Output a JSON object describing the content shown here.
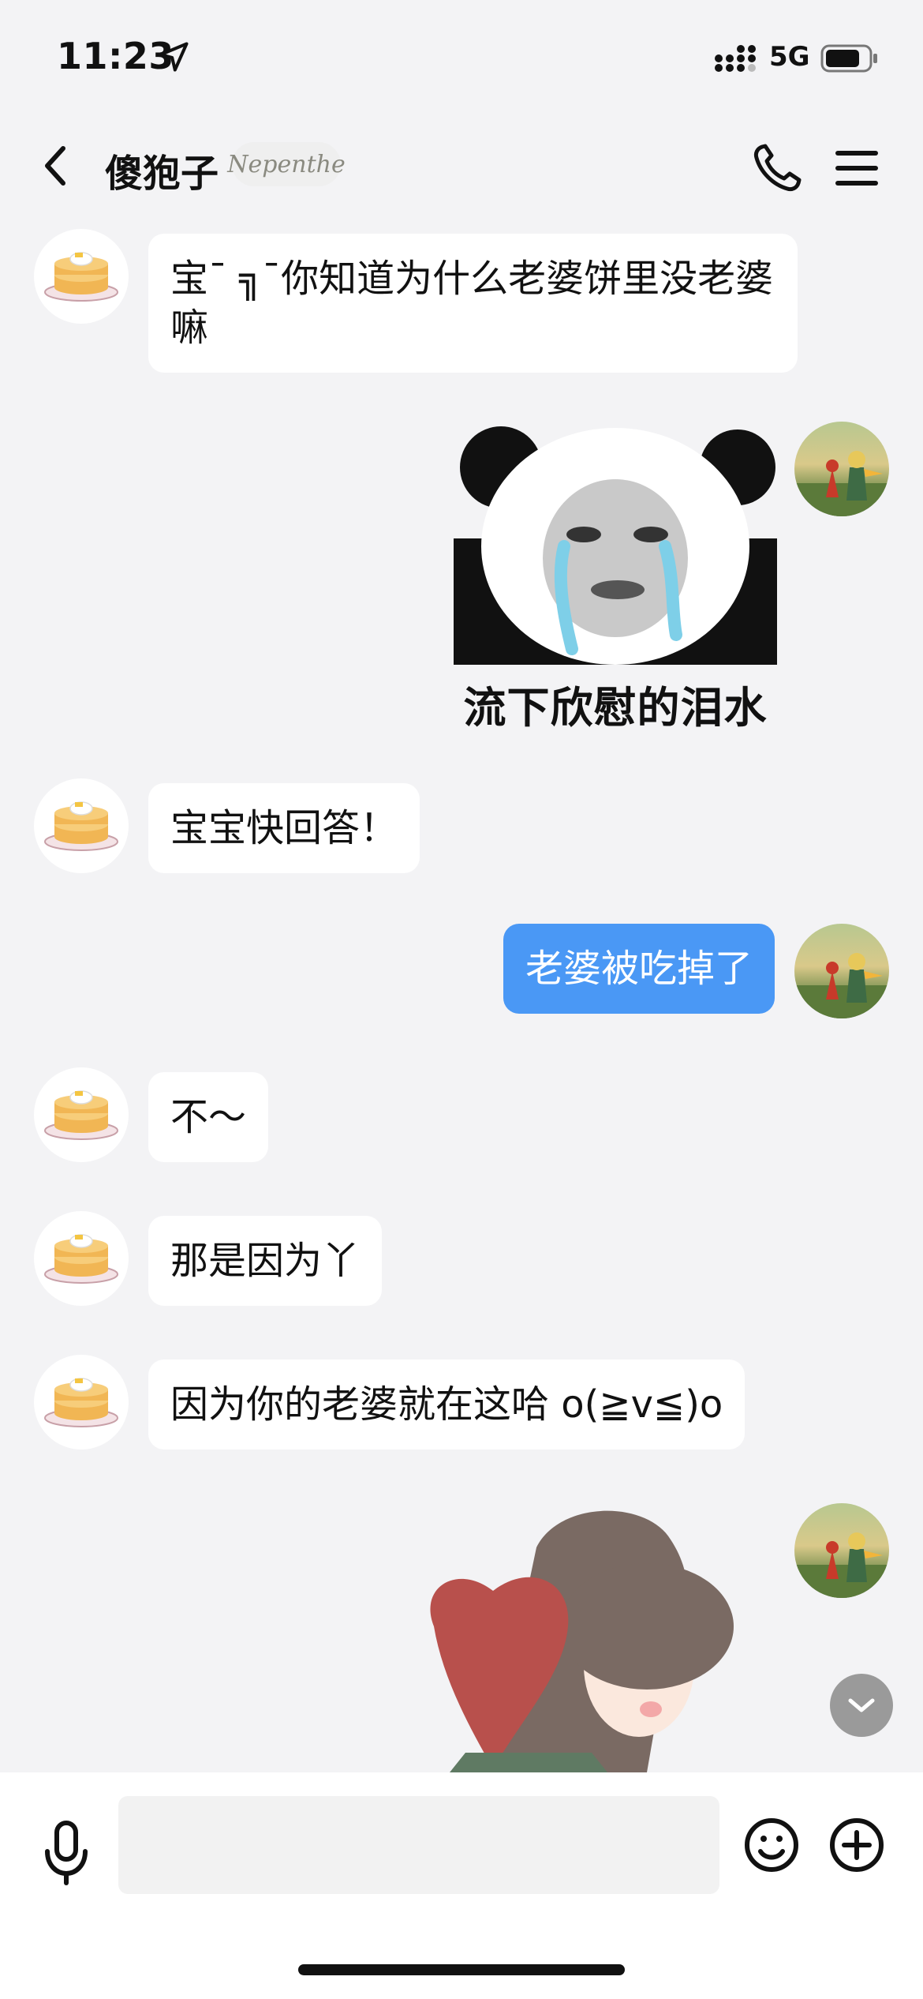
{
  "status_bar": {
    "time": "11:23",
    "network": "5G",
    "icons": [
      "location-arrow-icon",
      "signal-icon",
      "battery-icon"
    ]
  },
  "header": {
    "back_icon": "chevron-left-icon",
    "contact_name": "傻狍子",
    "badge_text": "Nepenthe",
    "call_icon": "phone-icon",
    "menu_icon": "menu-icon"
  },
  "messages": [
    {
      "sender": "contact",
      "type": "text",
      "text": "宝ˉ ╗ˉ你知道为什么老婆饼里没老婆嘛"
    },
    {
      "sender": "me",
      "type": "sticker",
      "caption": "流下欣慰的泪水"
    },
    {
      "sender": "contact",
      "type": "text",
      "text": "宝宝快回答！"
    },
    {
      "sender": "me",
      "type": "text",
      "text": "老婆被吃掉了"
    },
    {
      "sender": "contact",
      "type": "text",
      "text": "不～"
    },
    {
      "sender": "contact",
      "type": "text",
      "text": "那是因为丫"
    },
    {
      "sender": "contact",
      "type": "text",
      "text": "因为你的老婆就在这哈 o(≧v≦)o"
    },
    {
      "sender": "me",
      "type": "sticker",
      "caption": ""
    }
  ],
  "input_bar": {
    "placeholder": "",
    "icons": [
      "microphone-icon",
      "emoji-icon",
      "plus-icon"
    ]
  },
  "colors": {
    "background": "#f3f3f5",
    "outgoing_bubble": "#4a98f5",
    "incoming_bubble": "#ffffff"
  }
}
